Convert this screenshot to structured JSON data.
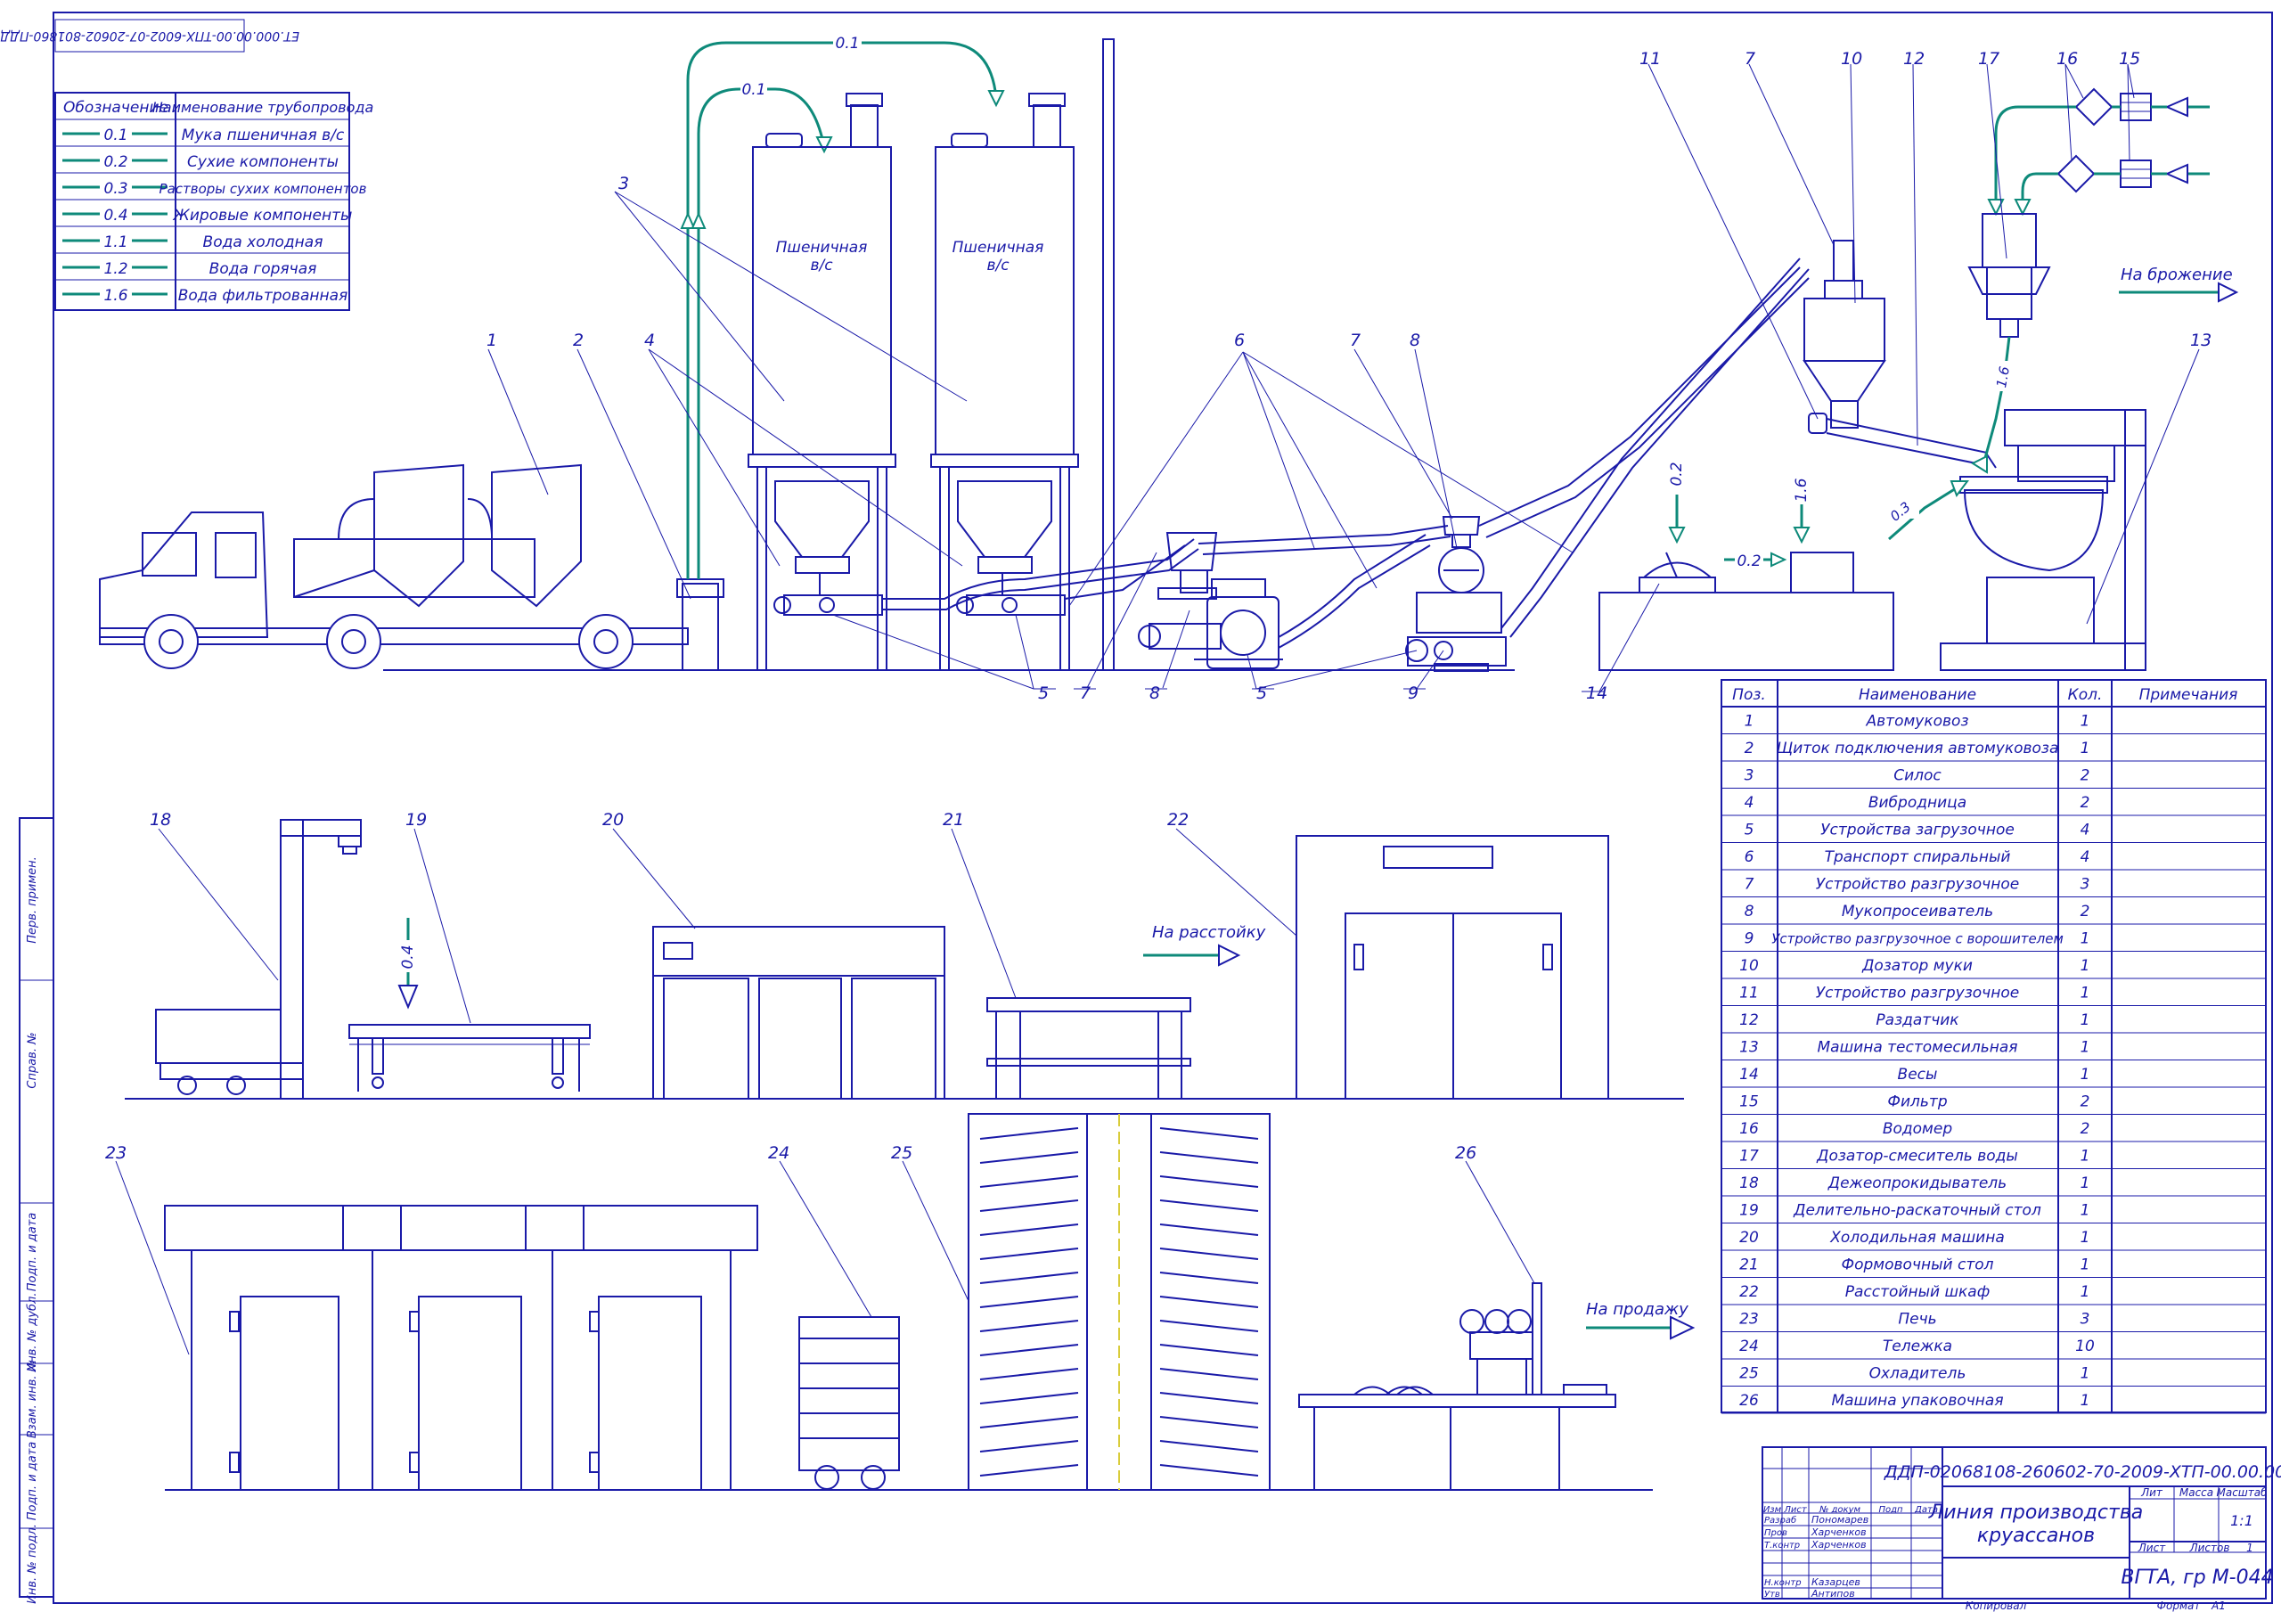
{
  "drawing_code_rotated": "ЕТ.000.00.00-ТПХ-6002-07-20602-801860-ПДД",
  "pipe_legend": {
    "header_code": "Обозначение",
    "header_name": "Наименование трубопровода",
    "rows": [
      {
        "code": "0.1",
        "name": "Мука пшеничная в/с"
      },
      {
        "code": "0.2",
        "name": "Сухие компоненты"
      },
      {
        "code": "0.3",
        "name": "Растворы сухих компонентов"
      },
      {
        "code": "0.4",
        "name": "Жировые компоненты"
      },
      {
        "code": "1.1",
        "name": "Вода холодная"
      },
      {
        "code": "1.2",
        "name": "Вода горячая"
      },
      {
        "code": "1.6",
        "name": "Вода фильтрованная"
      }
    ]
  },
  "silo_labels": [
    "Пшеничная",
    "в/с",
    "Пшеничная",
    "в/с"
  ],
  "flow_labels": {
    "fermentation": "На брожение",
    "proofing": "На расстойку",
    "sale": "На продажу"
  },
  "pipe_codes": [
    "0.1",
    "0.1",
    "0.2",
    "0.2",
    "1.6",
    "0.3",
    "1.6",
    "0.4"
  ],
  "callouts": [
    "1",
    "2",
    "3",
    "4",
    "5",
    "5",
    "5",
    "6",
    "7",
    "7",
    "7",
    "8",
    "8",
    "9",
    "10",
    "11",
    "12",
    "13",
    "14",
    "15",
    "16",
    "17",
    "18",
    "19",
    "20",
    "21",
    "22",
    "23",
    "24",
    "25",
    "26"
  ],
  "spec": {
    "headers": [
      "Поз.",
      "Наименование",
      "Кол.",
      "Примечания"
    ],
    "rows": [
      {
        "pos": "1",
        "name": "Автомуковоз",
        "qty": "1"
      },
      {
        "pos": "2",
        "name": "Щиток подключения автомуковоза",
        "qty": "1"
      },
      {
        "pos": "3",
        "name": "Силос",
        "qty": "2"
      },
      {
        "pos": "4",
        "name": "Вибродница",
        "qty": "2"
      },
      {
        "pos": "5",
        "name": "Устройства загрузочное",
        "qty": "4"
      },
      {
        "pos": "6",
        "name": "Транспорт спиральный",
        "qty": "4"
      },
      {
        "pos": "7",
        "name": "Устройство разгрузочное",
        "qty": "3"
      },
      {
        "pos": "8",
        "name": "Мукопросеиватель",
        "qty": "2"
      },
      {
        "pos": "9",
        "name": "Устройство разгрузочное с ворошителем",
        "qty": "1"
      },
      {
        "pos": "10",
        "name": "Дозатор муки",
        "qty": "1"
      },
      {
        "pos": "11",
        "name": "Устройство разгрузочное",
        "qty": "1"
      },
      {
        "pos": "12",
        "name": "Раздатчик",
        "qty": "1"
      },
      {
        "pos": "13",
        "name": "Машина тестомесильная",
        "qty": "1"
      },
      {
        "pos": "14",
        "name": "Весы",
        "qty": "1"
      },
      {
        "pos": "15",
        "name": "Фильтр",
        "qty": "2"
      },
      {
        "pos": "16",
        "name": "Водомер",
        "qty": "2"
      },
      {
        "pos": "17",
        "name": "Дозатор-смеситель воды",
        "qty": "1"
      },
      {
        "pos": "18",
        "name": "Дежеопрокидыватель",
        "qty": "1"
      },
      {
        "pos": "19",
        "name": "Делительно-раскаточный стол",
        "qty": "1"
      },
      {
        "pos": "20",
        "name": "Холодильная машина",
        "qty": "1"
      },
      {
        "pos": "21",
        "name": "Формовочный стол",
        "qty": "1"
      },
      {
        "pos": "22",
        "name": "Расстойный шкаф",
        "qty": "1"
      },
      {
        "pos": "23",
        "name": "Печь",
        "qty": "3"
      },
      {
        "pos": "24",
        "name": "Тележка",
        "qty": "10"
      },
      {
        "pos": "25",
        "name": "Охладитель",
        "qty": "1"
      },
      {
        "pos": "26",
        "name": "Машина упаковочная",
        "qty": "1"
      }
    ]
  },
  "title_block": {
    "doc_code": "ДДП-02068108-260602-70-2009-ХТП-00.00.000 ТЗ",
    "title_line1": "Линия производства",
    "title_line2": "круассанов",
    "col_heads": [
      "Изм",
      "Лист",
      "№ докум",
      "Подп",
      "Дата"
    ],
    "roles": [
      "Разраб",
      "Пров",
      "Т.контр",
      "Н.контр",
      "Утв"
    ],
    "names": [
      "Пономарев",
      "Харченков",
      "Харченков",
      "Казарцев",
      "Антипов"
    ],
    "lit": "Лит",
    "mass": "Масса",
    "scale": "Масштаб",
    "scale_value": "1:1",
    "sheet": "Лист",
    "sheets": "Листов",
    "sheets_value": "1",
    "org": "ВГТА, гр М-044",
    "copied": "Копировал",
    "format": "Формат",
    "format_value": "А1"
  },
  "side_stamps": [
    "Перв. примен.",
    "Справ. №",
    "Подп. и дата",
    "Инв. № дубл.",
    "Взам. инв. №",
    "Подп. и дата",
    "Инв. № подл."
  ]
}
